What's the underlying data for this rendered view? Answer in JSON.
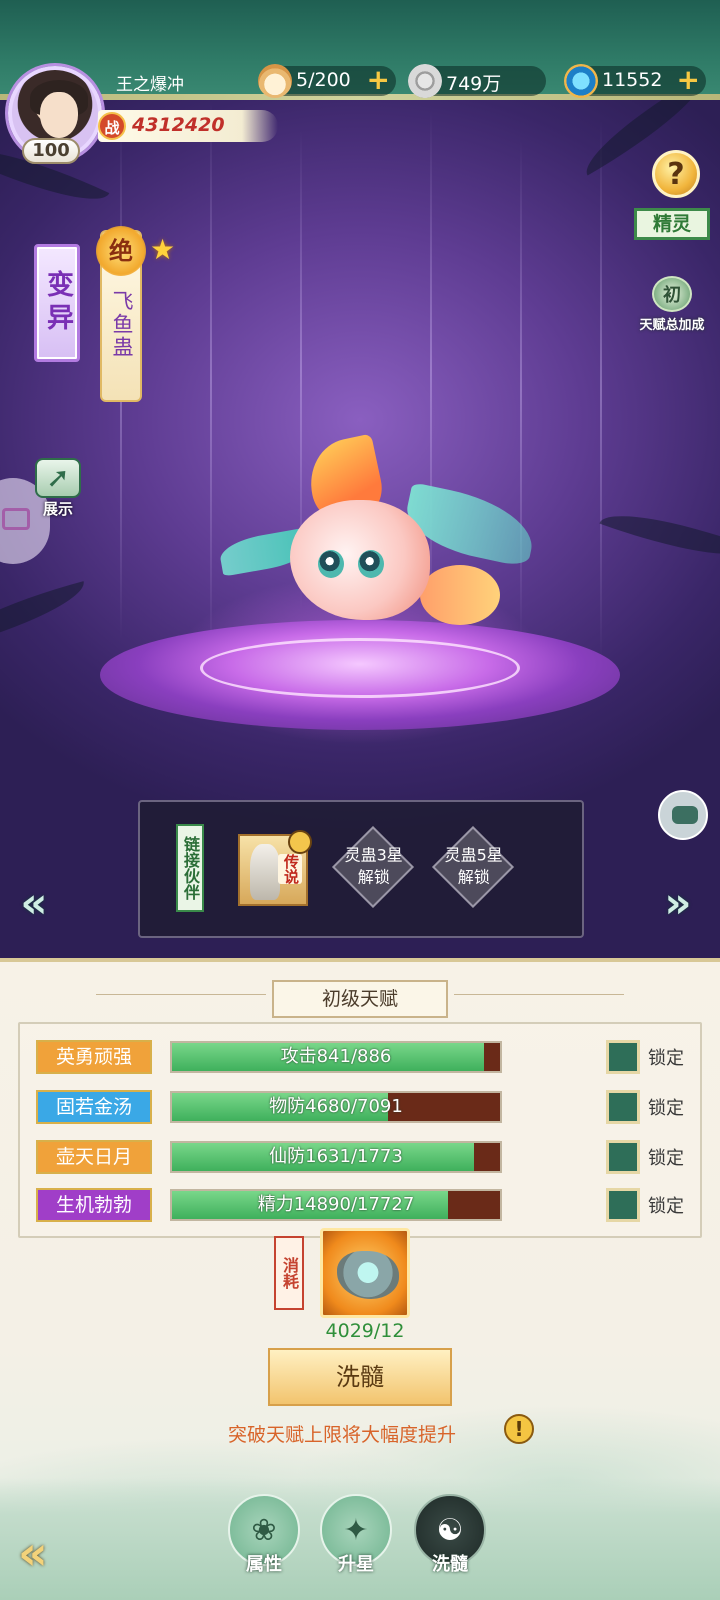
{
  "player": {
    "name": "王之爆冲",
    "level": "100",
    "power_icon": "战",
    "power": "4312420"
  },
  "resources": [
    {
      "icon": "steamed-bun-icon",
      "value": "5/200",
      "plus": "+"
    },
    {
      "icon": "coin-icon",
      "value": "749万"
    },
    {
      "icon": "jade-icon",
      "value": "11552",
      "plus": "+"
    }
  ],
  "side": {
    "help": "?",
    "spirit": "精灵",
    "talent_bonus_mark": "初",
    "talent_bonus_label": "天赋总加成",
    "mutate": "变异",
    "show": "展示"
  },
  "pet": {
    "tier_badge": "绝",
    "name": "飞鱼蛊",
    "star": "★"
  },
  "partner": {
    "tag": "链接伙伴",
    "hero_badge": "传说",
    "slots": [
      "灵蛊3星解锁",
      "灵蛊5星解锁"
    ]
  },
  "nav_arrows": {
    "left": "«",
    "right": "»"
  },
  "talent": {
    "title": "初级天赋",
    "rows": [
      {
        "name": "英勇顽强",
        "label": "攻击841/886",
        "fill": 0.95,
        "color": "#f0a23a",
        "lock": "锁定"
      },
      {
        "name": "固若金汤",
        "label": "物防4680/7091",
        "fill": 0.66,
        "color": "#3aa8e6",
        "lock": "锁定"
      },
      {
        "name": "壶天日月",
        "label": "仙防1631/1773",
        "fill": 0.92,
        "color": "#f0a23a",
        "lock": "锁定"
      },
      {
        "name": "生机勃勃",
        "label": "精力14890/17727",
        "fill": 0.84,
        "color": "#a03ec8",
        "lock": "锁定"
      }
    ]
  },
  "consume": {
    "tag": "消耗",
    "count": "4029/12",
    "button": "洗髓",
    "tip": "突破天赋上限将大幅度提升",
    "tip_icon": "!"
  },
  "bottom_nav": {
    "back": "«",
    "tabs": [
      {
        "label": "属性",
        "icon": "caterpillar-icon",
        "glyph": "❀",
        "active": false
      },
      {
        "label": "升星",
        "icon": "stars-icon",
        "glyph": "✦",
        "active": false
      },
      {
        "label": "洗髓",
        "icon": "swirl-icon",
        "glyph": "☯",
        "active": true
      }
    ]
  }
}
